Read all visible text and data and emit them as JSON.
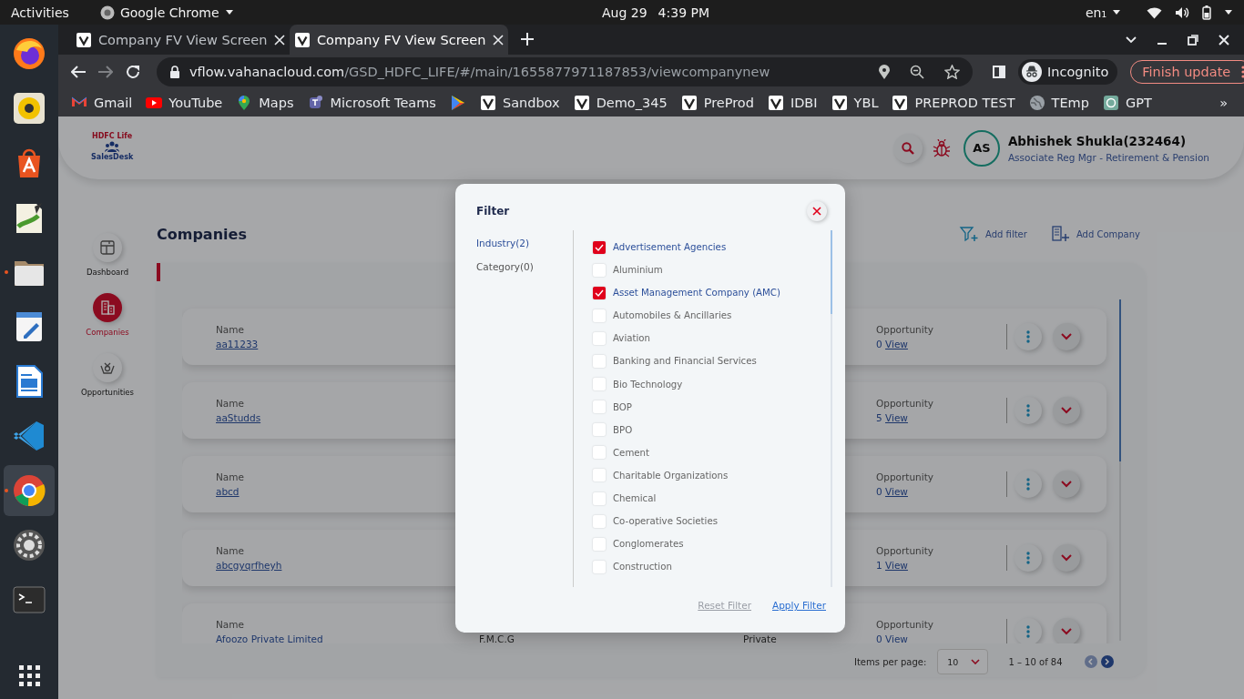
{
  "top_bar": {
    "activities": "Activities",
    "app_menu": "Google Chrome",
    "date": "Aug 29",
    "time": "4:39 PM",
    "input_source": "en₁"
  },
  "dock": {
    "apps": [
      {
        "kind": "firefox",
        "running": false,
        "selected": false
      },
      {
        "kind": "music",
        "running": false,
        "selected": false
      },
      {
        "kind": "store",
        "running": false,
        "selected": false
      },
      {
        "kind": "notes",
        "running": false,
        "selected": false
      },
      {
        "kind": "files",
        "running": true,
        "selected": false
      },
      {
        "kind": "editor",
        "running": false,
        "selected": false
      },
      {
        "kind": "writer",
        "running": false,
        "selected": false
      },
      {
        "kind": "code",
        "running": false,
        "selected": false
      },
      {
        "kind": "chrome",
        "running": true,
        "selected": true
      },
      {
        "kind": "settings",
        "running": false,
        "selected": false
      },
      {
        "kind": "terminal",
        "running": false,
        "selected": false
      }
    ]
  },
  "browser": {
    "tabs": [
      {
        "title": "Company FV View Screen",
        "selected": false
      },
      {
        "title": "Company FV View Screen",
        "selected": true
      }
    ],
    "url": {
      "host": "vflow.vahanacloud.com",
      "path": "/GSD_HDFC_LIFE/#/main/1655877971187853/viewcompanynew"
    },
    "profile": "Incognito",
    "update_button": "Finish update",
    "bookmarks": [
      {
        "label": "Gmail",
        "kind": "gmail"
      },
      {
        "label": "YouTube",
        "kind": "youtube"
      },
      {
        "label": "Maps",
        "kind": "maps"
      },
      {
        "label": "Microsoft Teams",
        "kind": "teams"
      },
      {
        "kind": "play"
      },
      {
        "label": "Sandbox",
        "kind": "site"
      },
      {
        "label": "Demo_345",
        "kind": "site"
      },
      {
        "label": "PreProd",
        "kind": "site"
      },
      {
        "label": "IDBI",
        "kind": "site"
      },
      {
        "label": "YBL",
        "kind": "site"
      },
      {
        "label": "PREPROD TEST",
        "kind": "site"
      },
      {
        "label": "TEmp",
        "kind": "globe"
      },
      {
        "label": "GPT",
        "kind": "gpt"
      }
    ],
    "more_bookmarks": "»"
  },
  "app": {
    "logo": {
      "top": "HDFC Life",
      "bottom": "SalesDesk"
    },
    "user": {
      "initials": "AS",
      "name": "Abhishek Shukla(232464)",
      "role": "Associate Reg Mgr - Retirement & Pension"
    },
    "nav": [
      {
        "label": "Dashboard",
        "kind": "dashboard",
        "selected": false
      },
      {
        "label": "Companies",
        "kind": "companies",
        "selected": true
      },
      {
        "label": "Opportunities",
        "kind": "opportunities",
        "selected": false
      }
    ],
    "page_title": "Companies",
    "actions": [
      {
        "label": "Add filter",
        "kind": "filter"
      },
      {
        "label": "Add Company",
        "kind": "company"
      }
    ],
    "companies": [
      {
        "name_label": "Name",
        "name": "aa11233",
        "opportunity_label": "Opportunity",
        "opportunity_count": "0",
        "opportunity_link": "View"
      },
      {
        "name_label": "Name",
        "name": "aaStudds",
        "opportunity_label": "Opportunity",
        "opportunity_count": "5",
        "opportunity_link": "View"
      },
      {
        "name_label": "Name",
        "name": "abcd",
        "opportunity_label": "Opportunity",
        "opportunity_count": "0",
        "opportunity_link": "View"
      },
      {
        "name_label": "Name",
        "name": "abcgyqrfheyh",
        "opportunity_label": "Opportunity",
        "opportunity_count": "1",
        "opportunity_link": "View"
      },
      {
        "name_label": "Name",
        "name": "Afoozo Private Limited",
        "column_2": "F.M.C.G",
        "column_3": "Private",
        "opportunity_label": "Opportunity",
        "opportunity_count": "0",
        "opportunity_link": "View"
      }
    ],
    "pagination": {
      "label": "Items per page:",
      "page_size": "10",
      "range": "1 – 10 of 84"
    }
  },
  "filter_dialog": {
    "title": "Filter",
    "groups": [
      {
        "label": "Industry(2)",
        "selected": true
      },
      {
        "label": "Category(0)",
        "selected": false
      }
    ],
    "options": [
      {
        "label": "Advertisement Agencies",
        "checked": true
      },
      {
        "label": "Aluminium",
        "checked": false
      },
      {
        "label": "Asset Management Company (AMC)",
        "checked": true
      },
      {
        "label": "Automobiles & Ancillaries",
        "checked": false
      },
      {
        "label": "Aviation",
        "checked": false
      },
      {
        "label": "Banking and Financial Services",
        "checked": false
      },
      {
        "label": "Bio Technology",
        "checked": false
      },
      {
        "label": "BOP",
        "checked": false
      },
      {
        "label": "BPO",
        "checked": false
      },
      {
        "label": "Cement",
        "checked": false
      },
      {
        "label": "Charitable Organizations",
        "checked": false
      },
      {
        "label": "Chemical",
        "checked": false
      },
      {
        "label": "Co-operative Societies",
        "checked": false
      },
      {
        "label": "Conglomerates",
        "checked": false
      },
      {
        "label": "Construction",
        "checked": false
      }
    ],
    "reset": "Reset Filter",
    "apply": "Apply Filter"
  }
}
